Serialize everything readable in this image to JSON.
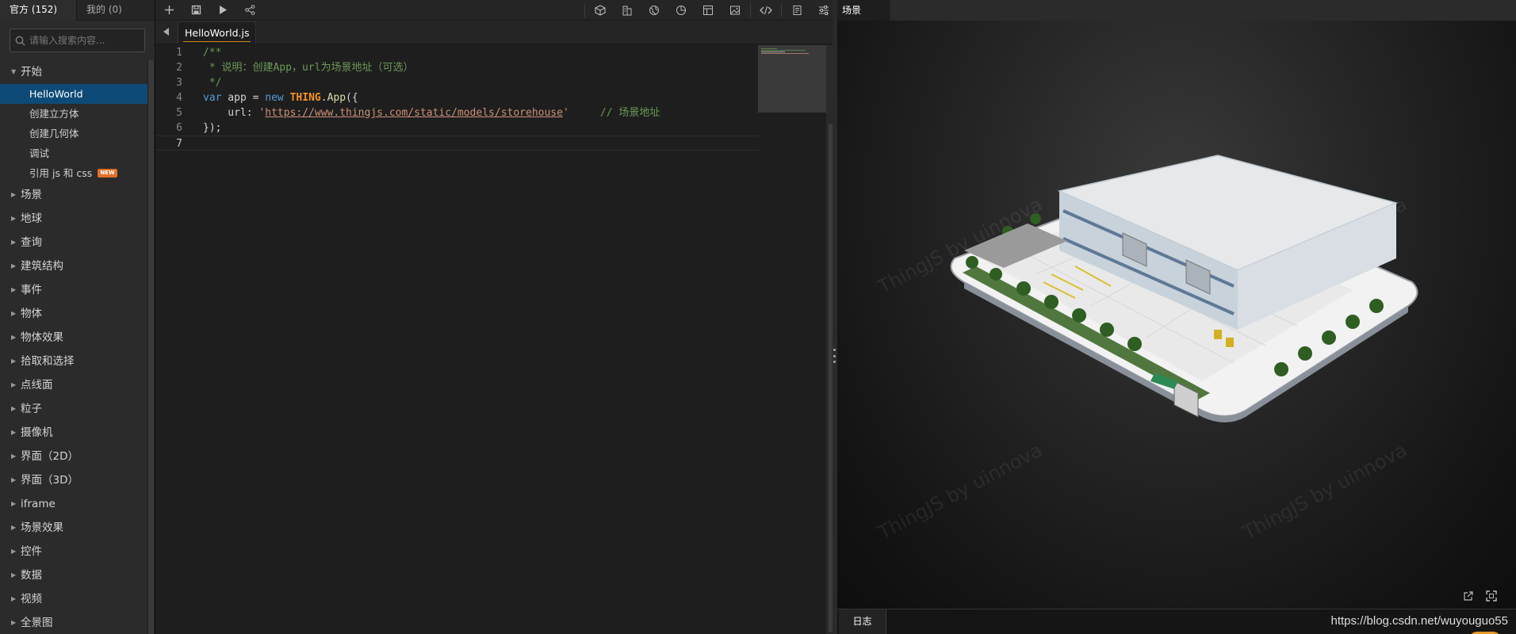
{
  "sidebar": {
    "tabs": [
      {
        "label": "官方 (152)"
      },
      {
        "label": "我的 (0)"
      }
    ],
    "search_placeholder": "请输入搜索内容...",
    "start_group": "开始",
    "start_items": [
      {
        "label": "HelloWorld"
      },
      {
        "label": "创建立方体"
      },
      {
        "label": "创建几何体"
      },
      {
        "label": "调试"
      },
      {
        "label": "引用 js 和 css",
        "badge": "NEW"
      }
    ],
    "groups": [
      {
        "label": "场景"
      },
      {
        "label": "地球"
      },
      {
        "label": "查询"
      },
      {
        "label": "建筑结构"
      },
      {
        "label": "事件"
      },
      {
        "label": "物体"
      },
      {
        "label": "物体效果"
      },
      {
        "label": "拾取和选择"
      },
      {
        "label": "点线面"
      },
      {
        "label": "粒子"
      },
      {
        "label": "摄像机"
      },
      {
        "label": "界面（2D）"
      },
      {
        "label": "界面（3D）"
      },
      {
        "label": "iframe"
      },
      {
        "label": "场景效果"
      },
      {
        "label": "控件"
      },
      {
        "label": "数据"
      },
      {
        "label": "视频"
      },
      {
        "label": "全景图"
      }
    ]
  },
  "editor": {
    "file_tab": "HelloWorld.js",
    "line_numbers": [
      "1",
      "2",
      "3",
      "4",
      "5",
      "6",
      "7"
    ],
    "code": {
      "l1": "/**",
      "l2": " * 说明：创建App，url为场景地址（可选）",
      "l3": " */",
      "l4_kw": "var",
      "l4_mid": " app = ",
      "l4_new": "new",
      "l4_cls": "THING",
      "l4_dot": ".",
      "l4_fn": "App",
      "l4_end": "({",
      "l5_key": "    url: ",
      "l5_q1": "'",
      "l5_url": "https://www.thingjs.com/static/models/storehouse",
      "l5_q2": "'",
      "l5_comment": "     // 场景地址",
      "l6": "});",
      "l7": ""
    }
  },
  "scene": {
    "tab": "场景",
    "watermark": "ThingJS by uinnova",
    "log_tab": "日志",
    "footer_url": "https://blog.csdn.net/wuyouguo55"
  },
  "colors": {
    "accent_selected": "#0e4a77",
    "badge": "#e0702a",
    "tab_underline": "#d48a1a"
  }
}
